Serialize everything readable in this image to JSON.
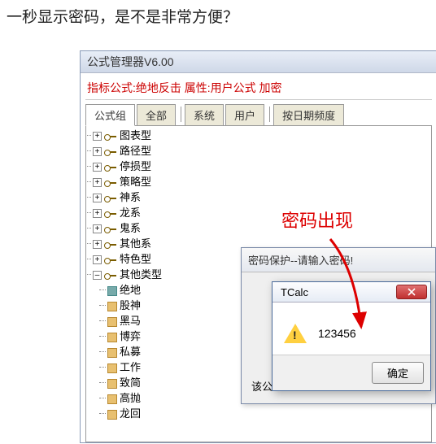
{
  "caption": "一秒显示密码，是不是非常方便？",
  "window": {
    "title": "公式管理器V6.00",
    "info_line": "指标公式:绝地反击 属性:用户公式 加密",
    "tabs": [
      "公式组",
      "全部",
      "系统",
      "用户",
      "按日期频度"
    ]
  },
  "tree": {
    "folders": [
      "图表型",
      "路径型",
      "停损型",
      "策略型",
      "神系",
      "龙系",
      "鬼系",
      "其他系",
      "特色型"
    ],
    "expanded_folder": "其他类型",
    "leaves": [
      "绝地",
      "股神",
      "黑马",
      "博弈",
      "私募",
      "工作",
      "致简",
      "高抛",
      "龙回"
    ]
  },
  "dialog1": {
    "title": "密码保护--请输入密码!",
    "body_prefix": "该公"
  },
  "dialog2": {
    "title": "TCalc",
    "password": "123456",
    "ok": "确定"
  },
  "annotation": "密码出现"
}
